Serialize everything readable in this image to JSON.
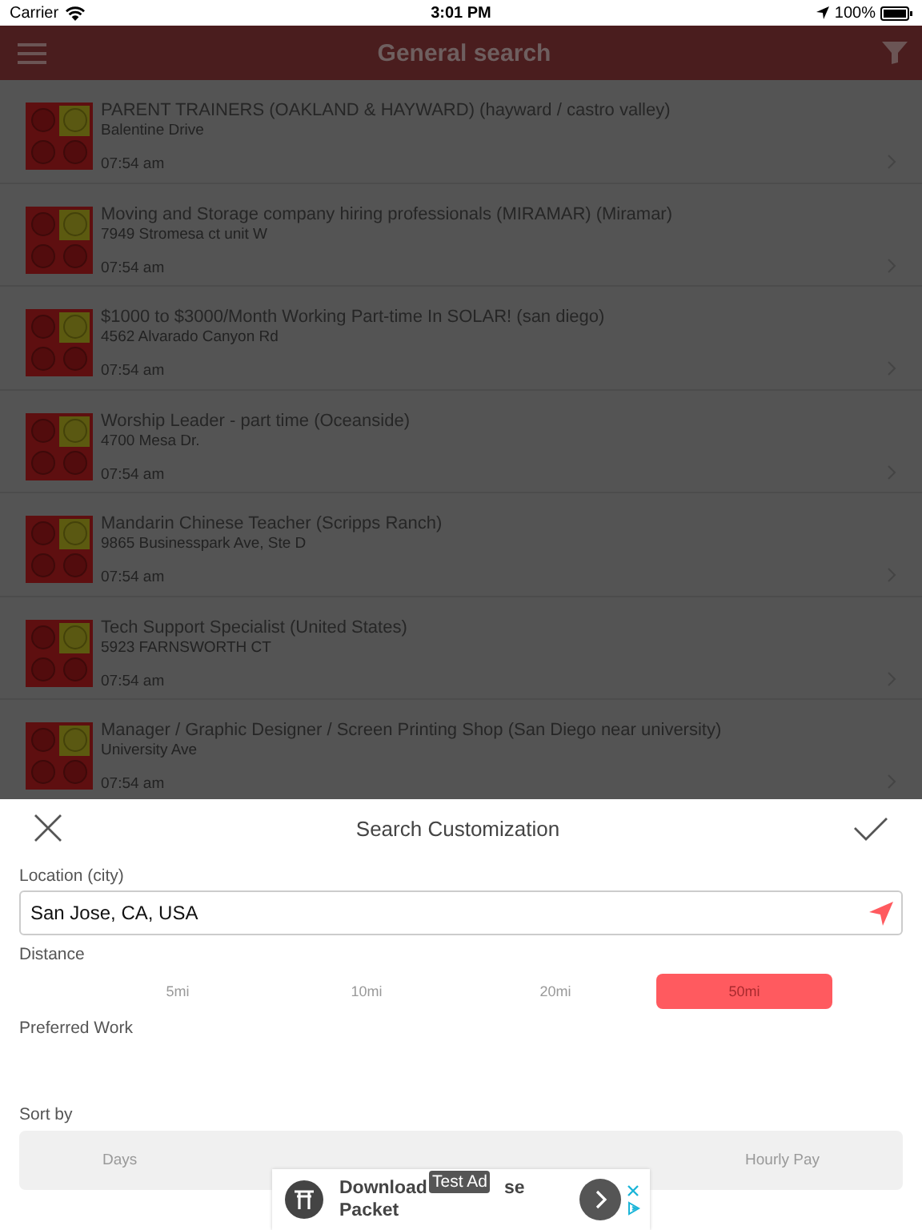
{
  "status_bar": {
    "carrier": "Carrier",
    "time": "3:01 PM",
    "battery": "100%"
  },
  "nav_bar": {
    "title": "General search"
  },
  "listings": [
    {
      "title": "PARENT TRAINERS (OAKLAND & HAYWARD) (hayward / castro valley)",
      "address": "Balentine Drive",
      "time": "07:54 am"
    },
    {
      "title": "Moving and Storage company hiring professionals (MIRAMAR) (Miramar)",
      "address": "7949 Stromesa ct unit W",
      "time": "07:54 am"
    },
    {
      "title": "$1000 to $3000/Month Working Part-time In SOLAR! (san diego)",
      "address": "4562 Alvarado Canyon Rd",
      "time": "07:54 am"
    },
    {
      "title": "Worship Leader - part time (Oceanside)",
      "address": "4700 Mesa Dr.",
      "time": "07:54 am"
    },
    {
      "title": "Mandarin Chinese Teacher (Scripps Ranch)",
      "address": "9865 Businesspark Ave, Ste D",
      "time": "07:54 am"
    },
    {
      "title": "Tech Support Specialist (United States)",
      "address": "5923 FARNSWORTH CT",
      "time": "07:54 am"
    },
    {
      "title": "Manager / Graphic Designer / Screen Printing Shop (San Diego near university)",
      "address": "University Ave",
      "time": "07:54 am"
    }
  ],
  "sheet": {
    "title": "Search Customization",
    "location_label": "Location (city)",
    "location_value": "San Jose, CA, USA",
    "distance_label": "Distance",
    "distances": [
      {
        "label": "5mi",
        "selected": false
      },
      {
        "label": "10mi",
        "selected": false
      },
      {
        "label": "20mi",
        "selected": false
      },
      {
        "label": "50mi",
        "selected": true
      }
    ],
    "preferred_label": "Preferred Work",
    "sort_label": "Sort by",
    "sort_options": [
      {
        "label": "Days"
      },
      {
        "label": "Hourly Pay"
      }
    ]
  },
  "ad": {
    "badge": "Test Ad",
    "line_1a": "Download",
    "line_1b": "se",
    "line_2": "Packet"
  }
}
